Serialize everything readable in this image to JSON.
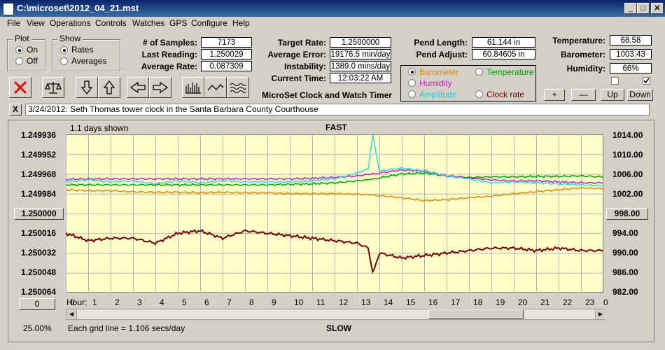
{
  "window": {
    "title": "C:\\microset\\2012_04_21.mst"
  },
  "menu": [
    "File",
    "View",
    "Operations",
    "Controls",
    "Watches",
    "GPS",
    "Configure",
    "Help"
  ],
  "plot": {
    "title": "Plot",
    "on": "On",
    "off": "Off"
  },
  "show": {
    "title": "Show",
    "rates": "Rates",
    "averages": "Averages"
  },
  "stats": {
    "samples_label": "# of Samples:",
    "samples": "7173",
    "last_label": "Last Reading:",
    "last": "1.250029",
    "avg_label": "Average Rate:",
    "avg": "0.087309",
    "target_label": "Target Rate:",
    "target": "1.2500000",
    "error_label": "Average Error:",
    "error": "19176.5 min/day",
    "instab_label": "Instability:",
    "instab": "1389.0 mins/day",
    "time_label": "Current Time:",
    "time": "12:03:22 AM",
    "pendlen_label": "Pend Length:",
    "pendlen": "61.144 in",
    "pendadj_label": "Pend Adjust:",
    "pendadj": "60.84605 in",
    "temp_label": "Temperature:",
    "temp": "68.58",
    "baro_label": "Barometer:",
    "baro": "1003.43",
    "hum_label": "Humidity:",
    "hum": "66%"
  },
  "subtitle": "MicroSet Clock and Watch Timer",
  "sensors": {
    "barometer": "Barometer",
    "temperature": "Temperature",
    "humidity": "Humidity",
    "amplitude": "Amplitude",
    "clockrate": "Clock rate"
  },
  "buttons": {
    "plus": "+",
    "minus": "—",
    "up": "Up",
    "down": "Down",
    "close_x": "X"
  },
  "note": "3/24/2012: Seth Thomas tower clock in the Santa Barbara County Courthouse",
  "chart": {
    "days_shown": "1.1 days shown",
    "top_label": "FAST",
    "bottom_label": "SLOW",
    "left_ticks": [
      "1.249936",
      "1.249952",
      "1.249968",
      "1.249984",
      "1.250000",
      "1.250016",
      "1.250032",
      "1.250048",
      "1.250064"
    ],
    "right_ticks": [
      "1014.00",
      "1010.00",
      "1006.00",
      "1002.00",
      "998.00",
      "994.00",
      "990.00",
      "986.00",
      "982.00"
    ],
    "left_center_btn": "1.250000",
    "right_center_btn": "998.00",
    "hour_label": "Hour:",
    "hours": [
      "0",
      "1",
      "2",
      "3",
      "4",
      "5",
      "6",
      "7",
      "8",
      "9",
      "10",
      "11",
      "12",
      "13",
      "14",
      "15",
      "16",
      "17",
      "18",
      "19",
      "20",
      "21",
      "22",
      "23",
      "0"
    ],
    "offset_btn": "0",
    "zoom": "25.00%",
    "grid_note": "Each grid line = 1.106 secs/day",
    "colors": {
      "bg": "#ffffc8",
      "grid": "#b4b4b4",
      "barometer": "#e08a00",
      "temperature": "#00a000",
      "humidity": "#c020c0",
      "amplitude": "#30d8e8",
      "rate": "#700000"
    }
  },
  "chart_data": {
    "type": "line",
    "title": "FAST",
    "xlabel": "Hour:",
    "x": [
      0,
      1,
      2,
      3,
      4,
      5,
      6,
      7,
      8,
      9,
      10,
      11,
      12,
      13,
      13.5,
      13.7,
      14,
      15,
      16,
      17,
      18,
      19,
      20,
      21,
      22,
      23,
      24
    ],
    "xlim": [
      0,
      24
    ],
    "ylim_left": [
      1.250064,
      1.249936
    ],
    "ylim_right": [
      982,
      1014
    ],
    "series": [
      {
        "name": "Clock rate",
        "axis": "left",
        "values": [
          1.250016,
          1.250022,
          1.25002,
          1.25002,
          1.250024,
          1.250016,
          1.250014,
          1.25002,
          1.250014,
          1.250016,
          1.250018,
          1.25002,
          1.250022,
          1.250024,
          1.250028,
          1.250048,
          1.250032,
          1.250036,
          1.250034,
          1.250032,
          1.25003,
          1.250028,
          1.250028,
          1.25003,
          1.250028,
          1.25003,
          1.25003
        ]
      },
      {
        "name": "Barometer",
        "axis": "right",
        "values": [
          1002.8,
          1002.6,
          1002.6,
          1002.4,
          1002.3,
          1002.3,
          1002.2,
          1002.3,
          1002.2,
          1002.2,
          1002.0,
          1002.0,
          1002.0,
          1001.9,
          1001.8,
          1001.8,
          1001.6,
          1001.2,
          1000.6,
          1000.8,
          1001.2,
          1001.5,
          1002.0,
          1002.4,
          1002.8,
          1003.2,
          1003.0
        ]
      },
      {
        "name": "Temperature",
        "axis": "right",
        "values": [
          1003.8,
          1003.8,
          1003.8,
          1003.8,
          1003.8,
          1003.8,
          1003.8,
          1003.8,
          1003.8,
          1003.8,
          1003.9,
          1004.0,
          1004.2,
          1004.6,
          1004.8,
          1005.0,
          1005.2,
          1006.0,
          1006.2,
          1005.6,
          1005.3,
          1005.4,
          1005.4,
          1005.5,
          1005.5,
          1005.6,
          1005.4
        ]
      },
      {
        "name": "Humidity",
        "axis": "right",
        "values": [
          1004.9,
          1005.0,
          1005.0,
          1005.0,
          1005.0,
          1005.0,
          1005.0,
          1005.0,
          1005.0,
          1005.0,
          1005.0,
          1005.1,
          1005.3,
          1005.6,
          1005.9,
          1006.0,
          1006.2,
          1006.8,
          1006.6,
          1005.6,
          1005.2,
          1004.8,
          1004.6,
          1004.6,
          1004.4,
          1004.2,
          1004.2
        ]
      },
      {
        "name": "Amplitude",
        "axis": "right",
        "values": [
          1004.4,
          1004.8,
          1004.4,
          1004.6,
          1004.0,
          1004.6,
          1004.2,
          1004.6,
          1004.4,
          1004.4,
          1004.4,
          1004.6,
          1005.0,
          1006.2,
          1007.0,
          1014.0,
          1006.6,
          1007.2,
          1006.6,
          1005.6,
          1005.0,
          1004.2,
          1004.4,
          1004.2,
          1004.0,
          1003.8,
          1003.6
        ]
      }
    ]
  }
}
